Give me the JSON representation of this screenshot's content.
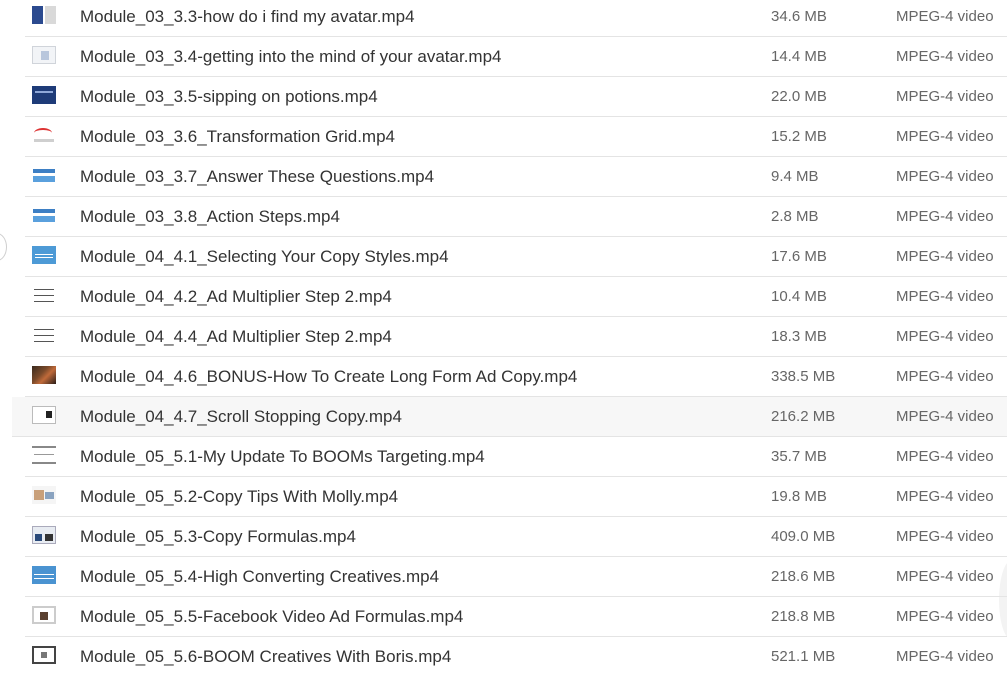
{
  "files": [
    {
      "name": "Module_03_3.3-how do i find my avatar.mp4",
      "size": "34.6 MB",
      "type": "MPEG-4 video",
      "thumb": "t-split",
      "thumb_icon": "video-thumbnail-icon"
    },
    {
      "name": "Module_03_3.4-getting into the mind of your avatar.mp4",
      "size": "14.4 MB",
      "type": "MPEG-4 video",
      "thumb": "t-doc",
      "thumb_icon": "video-thumbnail-icon"
    },
    {
      "name": "Module_03_3.5-sipping on potions.mp4",
      "size": "22.0 MB",
      "type": "MPEG-4 video",
      "thumb": "t-navy",
      "thumb_icon": "video-thumbnail-icon"
    },
    {
      "name": "Module_03_3.6_Transformation Grid.mp4",
      "size": "15.2 MB",
      "type": "MPEG-4 video",
      "thumb": "t-arrow",
      "thumb_icon": "video-thumbnail-icon"
    },
    {
      "name": "Module_03_3.7_Answer These Questions.mp4",
      "size": "9.4 MB",
      "type": "MPEG-4 video",
      "thumb": "t-brand",
      "thumb_icon": "video-thumbnail-icon"
    },
    {
      "name": "Module_03_3.8_Action Steps.mp4",
      "size": "2.8 MB",
      "type": "MPEG-4 video",
      "thumb": "t-brand",
      "thumb_icon": "video-thumbnail-icon"
    },
    {
      "name": "Module_04_4.1_Selecting Your Copy Styles.mp4",
      "size": "17.6 MB",
      "type": "MPEG-4 video",
      "thumb": "t-blue",
      "thumb_icon": "video-thumbnail-icon"
    },
    {
      "name": "Module_04_4.2_Ad Multiplier Step 2.mp4",
      "size": "10.4 MB",
      "type": "MPEG-4 video",
      "thumb": "t-lines",
      "thumb_icon": "video-thumbnail-icon"
    },
    {
      "name": "Module_04_4.4_Ad Multiplier Step 2.mp4",
      "size": "18.3 MB",
      "type": "MPEG-4 video",
      "thumb": "t-lines",
      "thumb_icon": "video-thumbnail-icon"
    },
    {
      "name": "Module_04_4.6_BONUS-How To Create Long Form Ad Copy.mp4",
      "size": "338.5 MB",
      "type": "MPEG-4 video",
      "thumb": "t-photo",
      "thumb_icon": "video-thumbnail-icon"
    },
    {
      "name": "Module_04_4.7_Scroll Stopping Copy.mp4",
      "size": "216.2 MB",
      "type": "MPEG-4 video",
      "thumb": "t-screen",
      "thumb_icon": "video-thumbnail-icon",
      "hover": true
    },
    {
      "name": "Module_05_5.1-My Update To BOOMs Targeting.mp4",
      "size": "35.7 MB",
      "type": "MPEG-4 video",
      "thumb": "t-screen2",
      "thumb_icon": "video-thumbnail-icon"
    },
    {
      "name": "Module_05_5.2-Copy Tips With Molly.mp4",
      "size": "19.8 MB",
      "type": "MPEG-4 video",
      "thumb": "t-collage",
      "thumb_icon": "video-thumbnail-icon"
    },
    {
      "name": "Module_05_5.3-Copy Formulas.mp4",
      "size": "409.0 MB",
      "type": "MPEG-4 video",
      "thumb": "t-grid",
      "thumb_icon": "video-thumbnail-icon"
    },
    {
      "name": "Module_05_5.4-High Converting Creatives.mp4",
      "size": "218.6 MB",
      "type": "MPEG-4 video",
      "thumb": "t-bluetext",
      "thumb_icon": "video-thumbnail-icon"
    },
    {
      "name": "Module_05_5.5-Facebook Video Ad Formulas.mp4",
      "size": "218.8 MB",
      "type": "MPEG-4 video",
      "thumb": "t-frame",
      "thumb_icon": "video-thumbnail-icon"
    },
    {
      "name": "Module_05_5.6-BOOM Creatives With Boris.mp4",
      "size": "521.1 MB",
      "type": "MPEG-4 video",
      "thumb": "t-box",
      "thumb_icon": "video-thumbnail-icon"
    }
  ]
}
